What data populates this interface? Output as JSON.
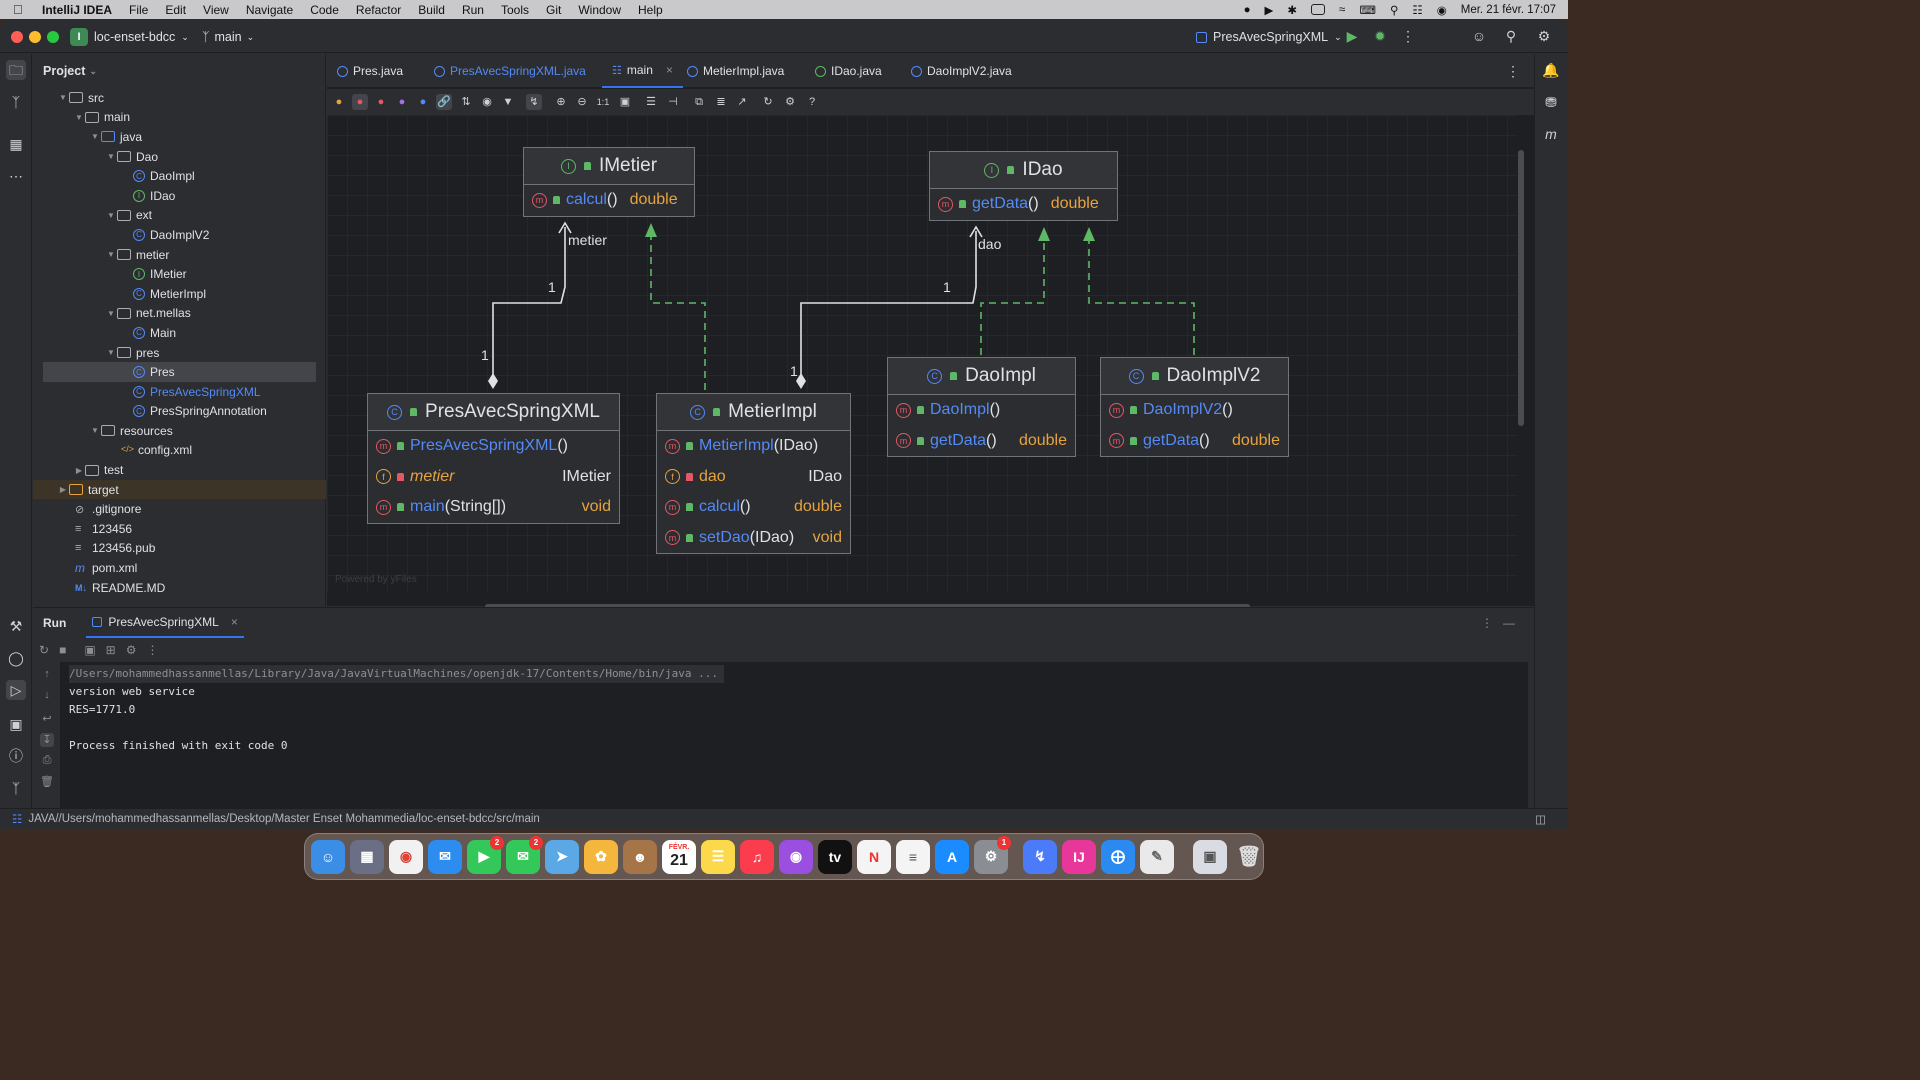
{
  "menubar": {
    "app": "IntelliJ IDEA",
    "items": [
      "File",
      "Edit",
      "View",
      "Navigate",
      "Code",
      "Refactor",
      "Build",
      "Run",
      "Tools",
      "Git",
      "Window",
      "Help"
    ],
    "clock": "Mer. 21 févr.  17:07"
  },
  "titlebar": {
    "project_badge": "I",
    "project": "loc-enset-bdcc",
    "branch": "main",
    "run_config": "PresAvecSpringXML"
  },
  "project_panel": {
    "title": "Project",
    "tree": [
      {
        "label": "src",
        "type": "folder"
      },
      {
        "label": "main",
        "type": "folder"
      },
      {
        "label": "java",
        "type": "folder"
      },
      {
        "label": "Dao",
        "type": "package"
      },
      {
        "label": "DaoImpl",
        "type": "class"
      },
      {
        "label": "IDao",
        "type": "interface"
      },
      {
        "label": "ext",
        "type": "package"
      },
      {
        "label": "DaoImplV2",
        "type": "class"
      },
      {
        "label": "metier",
        "type": "package"
      },
      {
        "label": "IMetier",
        "type": "interface"
      },
      {
        "label": "MetierImpl",
        "type": "class"
      },
      {
        "label": "net.mellas",
        "type": "package"
      },
      {
        "label": "Main",
        "type": "class"
      },
      {
        "label": "pres",
        "type": "package"
      },
      {
        "label": "Pres",
        "type": "class"
      },
      {
        "label": "PresAvecSpringXML",
        "type": "class"
      },
      {
        "label": "PresSpringAnnotation",
        "type": "class"
      },
      {
        "label": "resources",
        "type": "folder"
      },
      {
        "label": "config.xml",
        "type": "xml"
      },
      {
        "label": "test",
        "type": "folder"
      },
      {
        "label": "target",
        "type": "folder"
      },
      {
        "label": ".gitignore",
        "type": "file"
      },
      {
        "label": "123456",
        "type": "file"
      },
      {
        "label": "123456.pub",
        "type": "file"
      },
      {
        "label": "pom.xml",
        "type": "maven"
      },
      {
        "label": "README.MD",
        "type": "md"
      }
    ]
  },
  "tabs": [
    "Pres.java",
    "PresAvecSpringXML.java",
    "main",
    "MetierImpl.java",
    "IDao.java",
    "DaoImplV2.java"
  ],
  "diagram": {
    "powered": "Powered by yFiles",
    "edge_labels": {
      "metier": "metier",
      "dao": "dao",
      "one": "1"
    },
    "nodes": {
      "imetier": {
        "name": "IMetier",
        "rows": [
          {
            "m": "calcul",
            "a": "()",
            "t": "double"
          }
        ]
      },
      "idao": {
        "name": "IDao",
        "rows": [
          {
            "m": "getData",
            "a": "()",
            "t": "double"
          }
        ]
      },
      "pres": {
        "name": "PresAvecSpringXML",
        "ctor": "PresAvecSpringXML",
        "ctor_args": "()",
        "field": "metier",
        "field_type": "IMetier",
        "method": "main",
        "method_args": "(String[])",
        "method_type": "void"
      },
      "metierimpl": {
        "name": "MetierImpl",
        "ctor": "MetierImpl",
        "ctor_args": "(IDao)",
        "field": "dao",
        "field_type": "IDao",
        "m1": "calcul",
        "m1_args": "()",
        "m1_type": "double",
        "m2": "setDao",
        "m2_args": "(IDao)",
        "m2_type": "void"
      },
      "daoimpl": {
        "name": "DaoImpl",
        "ctor": "DaoImpl",
        "ctor_args": "()",
        "m": "getData",
        "m_args": "()",
        "m_type": "double"
      },
      "daoimplv2": {
        "name": "DaoImplV2",
        "ctor": "DaoImplV2",
        "ctor_args": "()",
        "m": "getData",
        "m_args": "()",
        "m_type": "double"
      }
    }
  },
  "run": {
    "title": "Run",
    "tab": "PresAvecSpringXML",
    "lines": [
      "/Users/mohammedhassanmellas/Library/Java/JavaVirtualMachines/openjdk-17/Contents/Home/bin/java ...",
      "version web service",
      "RES=1771.0",
      "",
      "Process finished with exit code 0"
    ]
  },
  "status": {
    "path": "JAVA//Users/mohammedhassanmellas/Desktop/Master Enset Mohammedia/loc-enset-bdcc/src/main"
  },
  "dock": {
    "calendar_month": "FÉVR.",
    "calendar_day": "21",
    "badges": {
      "facetime": "2",
      "messages": "2",
      "settings": "1"
    }
  }
}
